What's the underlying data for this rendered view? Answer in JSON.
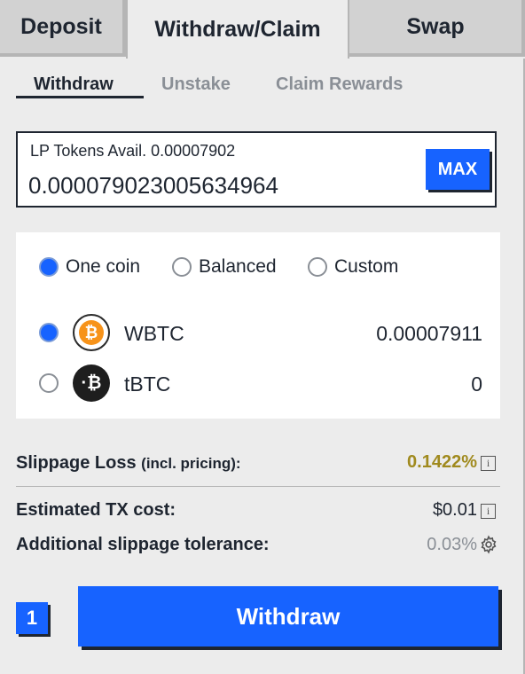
{
  "tabs": {
    "deposit": "Deposit",
    "withdraw_claim": "Withdraw/Claim",
    "swap": "Swap",
    "active": "Withdraw/Claim"
  },
  "subtabs": {
    "withdraw": "Withdraw",
    "unstake": "Unstake",
    "claim_rewards": "Claim Rewards",
    "active": "Withdraw"
  },
  "lp_input": {
    "avail_label": "LP Tokens Avail. 0.00007902",
    "value": "0.0000790230056349 64",
    "max_label": "MAX"
  },
  "withdraw_mode": {
    "options": [
      "One coin",
      "Balanced",
      "Custom"
    ],
    "selected": "One coin"
  },
  "coins": [
    {
      "name": "WBTC",
      "amount": "0.00007911",
      "selected": true,
      "icon": "bitcoin-icon"
    },
    {
      "name": "tBTC",
      "amount": "0",
      "selected": false,
      "icon": "tbtc-icon"
    }
  ],
  "info": {
    "slippage_label": "Slippage Loss",
    "slippage_sub": "(incl. pricing):",
    "slippage_value": "0.1422%",
    "tx_cost_label": "Estimated TX cost:",
    "tx_cost_value": "$0.01",
    "tolerance_label": "Additional slippage tolerance:",
    "tolerance_value": "0.03%"
  },
  "action": {
    "step": "1",
    "button_label": "Withdraw"
  },
  "colors": {
    "accent": "#1763ff",
    "slippage": "#a08a1e",
    "text": "#1e2530"
  }
}
